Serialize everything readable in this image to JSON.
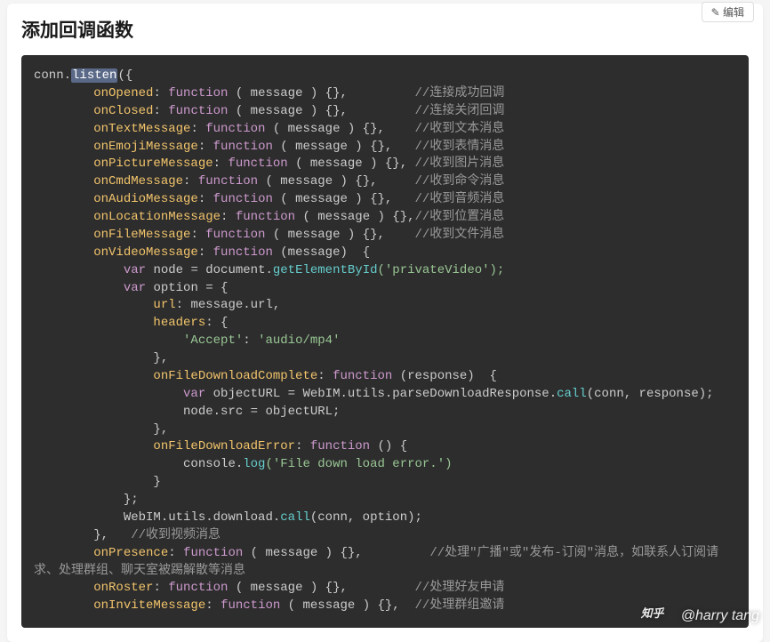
{
  "title": "添加回调函数",
  "edit_label": "编辑",
  "watermark": "@harry tang",
  "code": {
    "l1_a": "conn.",
    "l1_b": "listen",
    "l1_c": "({",
    "pad8": "        ",
    "pad4": "    ",
    "pad12": "            ",
    "pad16": "                ",
    "pad20": "                    ",
    "onOpened": "onOpened",
    "fn": "function",
    "msg_sig": " ( message ) {},",
    "cmt_onOpened": "//连接成功回调",
    "onClosed": "onClosed",
    "cmt_onClosed": "//连接关闭回调",
    "onTextMessage": "onTextMessage",
    "cmt_onText": "//收到文本消息",
    "onEmojiMessage": "onEmojiMessage",
    "cmt_onEmoji": "//收到表情消息",
    "onPictureMessage": "onPictureMessage",
    "cmt_onPic": "//收到图片消息",
    "onCmdMessage": "onCmdMessage",
    "cmt_onCmd": "//收到命令消息",
    "onAudioMessage": "onAudioMessage",
    "cmt_onAudio": "//收到音频消息",
    "onLocationMessage": "onLocationMessage",
    "cmt_onLoc": "//收到位置消息",
    "onFileMessage": "onFileMessage",
    "cmt_onFile": "//收到文件消息",
    "onVideoMessage": "onVideoMessage",
    "video_sig": " (message)  {",
    "var": "var",
    "node_eq": " node = document.",
    "getEl": "getElementById",
    "priv": "('privateVideo');",
    "option_eq": " option = {",
    "url_k": "url",
    "url_v": ": message.url,",
    "headers_k": "headers",
    "headers_v": ": {",
    "accept_k": "'Accept'",
    "accept_v": ": ",
    "accept_str": "'audio/mp4'",
    "close_brace_comma": "},",
    "onFileDownloadComplete": "onFileDownloadComplete",
    "resp_sig": " (response)  {",
    "objURL_a": " objectURL = WebIM.utils.parseDownloadResponse.",
    "call": "call",
    "objURL_b": "(conn, response);",
    "node_src": "node.src = objectURL;",
    "onFileDownloadError": "onFileDownloadError",
    "err_sig": " () {",
    "console_log": "console.",
    "log": "log",
    "err_str": "('File down load error.')",
    "close_brace": "}",
    "close_semi": "};",
    "webim_dl": "WebIM.utils.download.",
    "webim_dl_args": "(conn, option);",
    "video_close": "},   ",
    "cmt_onVideo": "//收到视频消息",
    "onPresence": "onPresence",
    "cmt_onPresence": "//处理\"广播\"或\"发布-订阅\"消息，如联系人订阅请求、处理群组、聊天室被踢解散等消息",
    "onRoster": "onRoster",
    "cmt_onRoster": "//处理好友申请",
    "onInviteMessage": "onInviteMessage",
    "cmt_onInvite": "//处理群组邀请"
  }
}
